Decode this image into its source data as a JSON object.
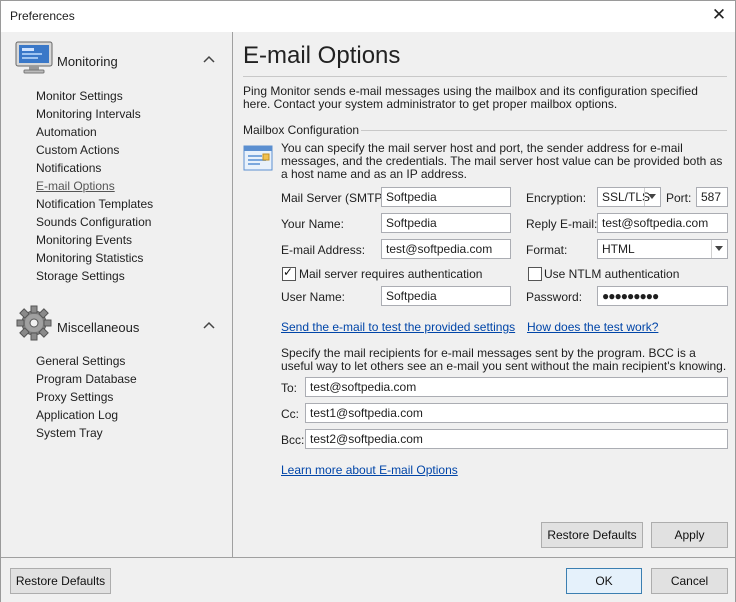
{
  "window": {
    "title": "Preferences",
    "close_icon": "close-icon"
  },
  "sidebar": {
    "groups": [
      {
        "title": "Monitoring",
        "icon": "monitor-icon",
        "items": [
          "Monitor Settings",
          "Monitoring Intervals",
          "Automation",
          "Custom Actions",
          "Notifications",
          "E-mail Options",
          "Notification Templates",
          "Sounds Configuration",
          "Monitoring Events",
          "Monitoring Statistics",
          "Storage Settings"
        ]
      },
      {
        "title": "Miscellaneous",
        "icon": "gear-icon",
        "items": [
          "General Settings",
          "Program Database",
          "Proxy Settings",
          "Application Log",
          "System Tray"
        ]
      }
    ],
    "selected": "E-mail Options"
  },
  "main": {
    "title": "E-mail Options",
    "intro": "Ping Monitor sends e-mail messages using the mailbox and its configuration specified here. Contact your system administrator to get proper mailbox options.",
    "section_title": "Mailbox Configuration",
    "section_desc": "You can specify the mail server host and port, the sender address for e-mail messages, and the credentials. The mail server host value can be provided both as a host name and as an IP address.",
    "fields": {
      "mail_server_label": "Mail Server (SMTP):",
      "mail_server_value": "Softpedia",
      "encryption_label": "Encryption:",
      "encryption_value": "SSL/TLS",
      "port_label": "Port:",
      "port_value": "587",
      "your_name_label": "Your Name:",
      "your_name_value": "Softpedia",
      "reply_email_label": "Reply E-mail:",
      "reply_email_value": "test@softpedia.com",
      "email_address_label": "E-mail Address:",
      "email_address_value": "test@softpedia.com",
      "format_label": "Format:",
      "format_value": "HTML",
      "auth_label": "Mail server requires authentication",
      "auth_checked": true,
      "ntlm_label": "Use NTLM authentication",
      "ntlm_checked": false,
      "user_name_label": "User Name:",
      "user_name_value": "Softpedia",
      "password_label": "Password:",
      "password_value": "●●●●●●●●●"
    },
    "links": {
      "send_test": "Send the e-mail to test the provided settings",
      "how_test": "How does the test work?",
      "learn_more": "Learn more about E-mail Options"
    },
    "recipients_desc": "Specify the mail recipients for e-mail messages sent by the program. BCC is a useful way to let others see an e-mail you sent without the main recipient's knowing.",
    "recipients": {
      "to_label": "To:",
      "to_value": "test@softpedia.com",
      "cc_label": "Cc:",
      "cc_value": "test1@softpedia.com",
      "bcc_label": "Bcc:",
      "bcc_value": "test2@softpedia.com"
    },
    "buttons": {
      "restore_defaults": "Restore Defaults",
      "apply": "Apply"
    }
  },
  "footer": {
    "restore_defaults": "Restore Defaults",
    "ok": "OK",
    "cancel": "Cancel"
  },
  "colors": {
    "link": "#0045a8",
    "window_bg": "#f0f0f0",
    "default_button_border": "#3c7fb1"
  }
}
